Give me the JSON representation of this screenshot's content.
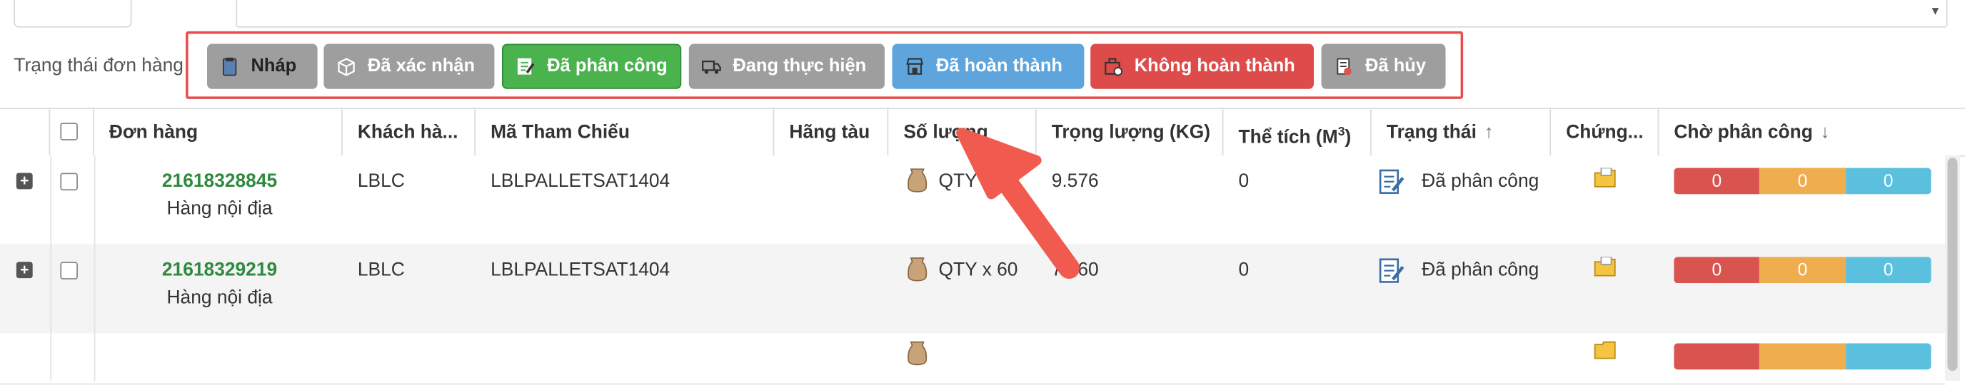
{
  "filter": {
    "label": "Trạng thái đơn hàng",
    "buttons": [
      {
        "key": "draft",
        "label": "Nháp",
        "color": "#9e9e9e"
      },
      {
        "key": "confirmed",
        "label": "Đã xác nhận",
        "color": "#9e9e9e"
      },
      {
        "key": "assigned",
        "label": "Đã phân công",
        "color": "#4ab34e",
        "active": true
      },
      {
        "key": "inprogress",
        "label": "Đang thực hiện",
        "color": "#9e9e9e"
      },
      {
        "key": "done",
        "label": "Đã hoàn thành",
        "color": "#5da5dc"
      },
      {
        "key": "notdone",
        "label": "Không hoàn thành",
        "color": "#dd4b4b"
      },
      {
        "key": "cancel",
        "label": "Đã hủy",
        "color": "#9e9e9e"
      }
    ]
  },
  "table": {
    "columns": {
      "order": "Đơn hàng",
      "customer": "Khách hà...",
      "reference": "Mã Tham Chiếu",
      "carrier": "Hãng tàu",
      "quantity": "Số lượng",
      "weight": "Trọng lượng (KG)",
      "volume": "Thể tích (M",
      "volume_sup": "3",
      "volume_close": ")",
      "status": "Trạng thái",
      "status_sort": "↑",
      "documents": "Chứng...",
      "pending": "Chờ phân công",
      "pending_sort": "↓"
    },
    "rows": [
      {
        "order_id": "21618328845",
        "order_type": "Hàng nội địa",
        "customer": "LBLC",
        "reference": "LBLPALLETSAT1404",
        "carrier": "",
        "quantity": "QTY x",
        "weight": "9.576",
        "volume": "0",
        "status": "Đã phân công",
        "pending": [
          "0",
          "0",
          "0"
        ]
      },
      {
        "order_id": "21618329219",
        "order_type": "Hàng nội địa",
        "customer": "LBLC",
        "reference": "LBLPALLETSAT1404",
        "carrier": "",
        "quantity": "QTY x 60",
        "weight": "7.560",
        "volume": "0",
        "status": "Đã phân công",
        "pending": [
          "0",
          "0",
          "0"
        ]
      }
    ]
  },
  "colors": {
    "highlight": "#e84c4c",
    "arrow": "#f05a4f",
    "order_id": "#2e8a3e"
  }
}
